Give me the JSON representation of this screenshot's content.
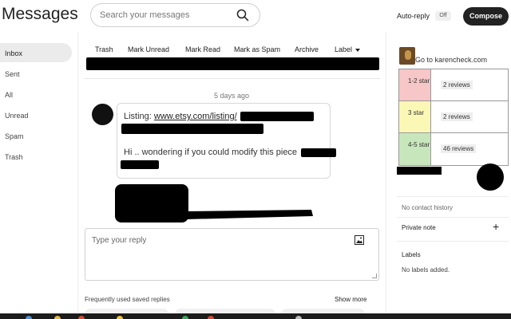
{
  "header": {
    "title": "Messages",
    "search_placeholder": "Search your messages",
    "autoreply_label": "Auto-reply",
    "autoreply_state": "Off",
    "compose_label": "Compose"
  },
  "sidebar": {
    "items": [
      {
        "label": "Inbox",
        "active": true
      },
      {
        "label": "Sent"
      },
      {
        "label": "All"
      },
      {
        "label": "Unread"
      },
      {
        "label": "Spam"
      },
      {
        "label": "Trash"
      }
    ]
  },
  "toolbar": {
    "trash": "Trash",
    "mark_unread": "Mark Unread",
    "mark_read": "Mark Read",
    "mark_spam": "Mark as Spam",
    "archive": "Archive",
    "label": "Label"
  },
  "conversation": {
    "timestamp": "5 days ago",
    "listing_prefix": "Listing: ",
    "listing_link": "www.etsy.com/listing/",
    "message_text": "Hi .. wondering if you could modify this piece"
  },
  "reply": {
    "placeholder": "Type your reply"
  },
  "saved_replies": {
    "title": "Frequently used saved replies",
    "show_more": "Show more"
  },
  "right_panel": {
    "shop_link": "Go to karencheck.com",
    "ratings": [
      {
        "stars": "1-2 star",
        "count": "2 reviews",
        "color": "#f7c6c6"
      },
      {
        "stars": "3 star",
        "count": "2 reviews",
        "color": "#fbf7b5"
      },
      {
        "stars": "4-5 star",
        "count": "46 reviews",
        "color": "#c8e6bc"
      }
    ],
    "no_contact_history": "No contact history",
    "private_note": "Private note",
    "labels_title": "Labels",
    "no_labels": "No labels added."
  }
}
